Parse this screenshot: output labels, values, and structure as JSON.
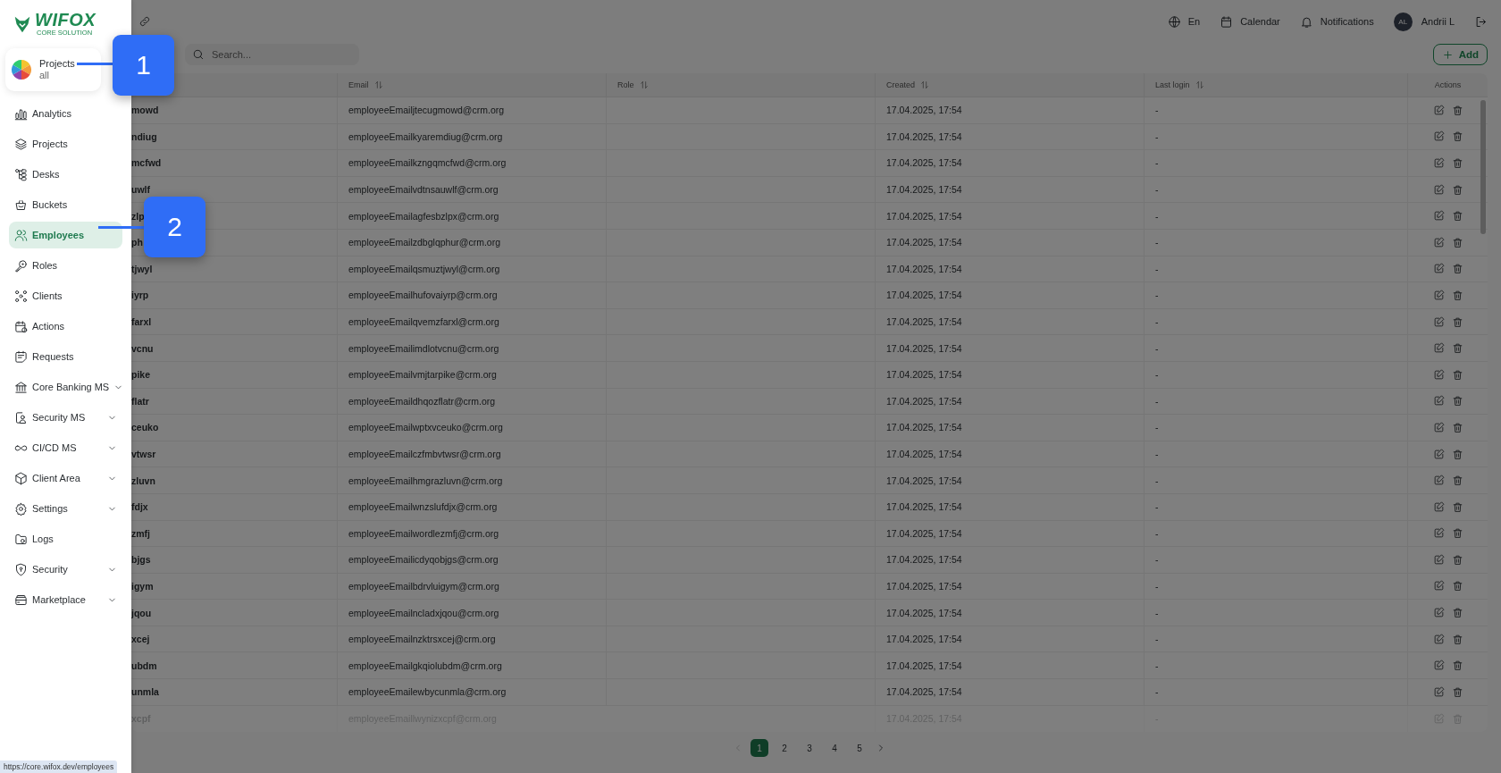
{
  "sidebar": {
    "logo": {
      "name": "WIFOX",
      "tagline": "CORE SOLUTION"
    },
    "project_selector": {
      "title": "Projects",
      "subtitle": "all"
    },
    "items": [
      {
        "label": "Analytics",
        "selected": false,
        "expandable": false
      },
      {
        "label": "Projects",
        "selected": false,
        "expandable": false
      },
      {
        "label": "Desks",
        "selected": false,
        "expandable": false
      },
      {
        "label": "Buckets",
        "selected": false,
        "expandable": false
      },
      {
        "label": "Employees",
        "selected": true,
        "expandable": false
      },
      {
        "label": "Roles",
        "selected": false,
        "expandable": false
      },
      {
        "label": "Clients",
        "selected": false,
        "expandable": false
      },
      {
        "label": "Actions",
        "selected": false,
        "expandable": false
      },
      {
        "label": "Requests",
        "selected": false,
        "expandable": false
      },
      {
        "label": "Core Banking MS",
        "selected": false,
        "expandable": true
      },
      {
        "label": "Security MS",
        "selected": false,
        "expandable": true
      },
      {
        "label": "CI/CD MS",
        "selected": false,
        "expandable": true
      },
      {
        "label": "Client Area",
        "selected": false,
        "expandable": true
      },
      {
        "label": "Settings",
        "selected": false,
        "expandable": true
      },
      {
        "label": "Logs",
        "selected": false,
        "expandable": false
      },
      {
        "label": "Security",
        "selected": false,
        "expandable": true
      },
      {
        "label": "Marketplace",
        "selected": false,
        "expandable": true
      }
    ]
  },
  "topbar": {
    "language": "En",
    "calendar": "Calendar",
    "notifications": "Notifications",
    "user": {
      "initials": "AL",
      "name": "Andrii L"
    }
  },
  "search": {
    "placeholder": "Search..."
  },
  "add_button": "Add",
  "table": {
    "columns": [
      {
        "label": "Email",
        "sortable": true
      },
      {
        "label": "Role",
        "sortable": true
      },
      {
        "label": "Created",
        "sortable": true
      },
      {
        "label": "Last login",
        "sortable": true
      },
      {
        "label": "Actions",
        "sortable": false
      }
    ],
    "rows": [
      {
        "column_1": "mowd",
        "email": "employeeEmailjtecugmowd@crm.org",
        "created": "17.04.2025, 17:54",
        "last_login": "-",
        "faded": false
      },
      {
        "column_1": "ndiug",
        "email": "employeeEmailkyaremdiug@crm.org",
        "created": "17.04.2025, 17:54",
        "last_login": "-",
        "faded": false
      },
      {
        "column_1": "mcfwd",
        "email": "employeeEmailkzngqmcfwd@crm.org",
        "created": "17.04.2025, 17:54",
        "last_login": "-",
        "faded": false
      },
      {
        "column_1": "uwlf",
        "email": "employeeEmailvdtnsauwlf@crm.org",
        "created": "17.04.2025, 17:54",
        "last_login": "-",
        "faded": false
      },
      {
        "column_1": "zlp",
        "email": "employeeEmailagfesbzlpx@crm.org",
        "created": "17.04.2025, 17:54",
        "last_login": "-",
        "faded": false
      },
      {
        "column_1": "ph",
        "email": "employeeEmailzdbglqphur@crm.org",
        "created": "17.04.2025, 17:54",
        "last_login": "-",
        "faded": false
      },
      {
        "column_1": "tjwyl",
        "email": "employeeEmailqsmuztjwyl@crm.org",
        "created": "17.04.2025, 17:54",
        "last_login": "-",
        "faded": false
      },
      {
        "column_1": "iyrp",
        "email": "employeeEmailhufovaiyrp@crm.org",
        "created": "17.04.2025, 17:54",
        "last_login": "-",
        "faded": false
      },
      {
        "column_1": "farxl",
        "email": "employeeEmailqvemzfarxl@crm.org",
        "created": "17.04.2025, 17:54",
        "last_login": "-",
        "faded": false
      },
      {
        "column_1": "vcnu",
        "email": "employeeEmailimdlotvcnu@crm.org",
        "created": "17.04.2025, 17:54",
        "last_login": "-",
        "faded": false
      },
      {
        "column_1": "pike",
        "email": "employeeEmailvmjtarpike@crm.org",
        "created": "17.04.2025, 17:54",
        "last_login": "-",
        "faded": false
      },
      {
        "column_1": "flatr",
        "email": "employeeEmaildhqozflatr@crm.org",
        "created": "17.04.2025, 17:54",
        "last_login": "-",
        "faded": false
      },
      {
        "column_1": "ceuko",
        "email": "employeeEmailwptxvceuko@crm.org",
        "created": "17.04.2025, 17:54",
        "last_login": "-",
        "faded": false
      },
      {
        "column_1": "vtwsr",
        "email": "employeeEmailczfmbvtwsr@crm.org",
        "created": "17.04.2025, 17:54",
        "last_login": "-",
        "faded": false
      },
      {
        "column_1": "zluvn",
        "email": "employeeEmailhmgrazluvn@crm.org",
        "created": "17.04.2025, 17:54",
        "last_login": "-",
        "faded": false
      },
      {
        "column_1": "fdjx",
        "email": "employeeEmailwnzslufdjx@crm.org",
        "created": "17.04.2025, 17:54",
        "last_login": "-",
        "faded": false
      },
      {
        "column_1": "zmfj",
        "email": "employeeEmailwordlezmfj@crm.org",
        "created": "17.04.2025, 17:54",
        "last_login": "-",
        "faded": false
      },
      {
        "column_1": "bjgs",
        "email": "employeeEmailicdyqobjgs@crm.org",
        "created": "17.04.2025, 17:54",
        "last_login": "-",
        "faded": false
      },
      {
        "column_1": "igym",
        "email": "employeeEmailbdrvluigym@crm.org",
        "created": "17.04.2025, 17:54",
        "last_login": "-",
        "faded": false
      },
      {
        "column_1": "jqou",
        "email": "employeeEmailncladxjqou@crm.org",
        "created": "17.04.2025, 17:54",
        "last_login": "-",
        "faded": false
      },
      {
        "column_1": "xcej",
        "email": "employeeEmailnzktrsxcej@crm.org",
        "created": "17.04.2025, 17:54",
        "last_login": "-",
        "faded": false
      },
      {
        "column_1": "ubdm",
        "email": "employeeEmailgkqiolubdm@crm.org",
        "created": "17.04.2025, 17:54",
        "last_login": "-",
        "faded": false
      },
      {
        "column_1": "unmla",
        "email": "employeeEmailewbycunmla@crm.org",
        "created": "17.04.2025, 17:54",
        "last_login": "-",
        "faded": false
      },
      {
        "column_1": "xcpf",
        "email": "employeeEmaillwynizxcpf@crm.org",
        "created": "17.04.2025, 17:54",
        "last_login": "-",
        "faded": true
      }
    ]
  },
  "pagination": {
    "pages": [
      {
        "label": "1",
        "selected": true
      },
      {
        "label": "2",
        "selected": false
      },
      {
        "label": "3",
        "selected": false
      },
      {
        "label": "4",
        "selected": false
      },
      {
        "label": "5",
        "selected": false
      }
    ]
  },
  "callouts": [
    {
      "number": "1"
    },
    {
      "number": "2"
    }
  ],
  "status_url": "https://core.wifox.dev/employees"
}
